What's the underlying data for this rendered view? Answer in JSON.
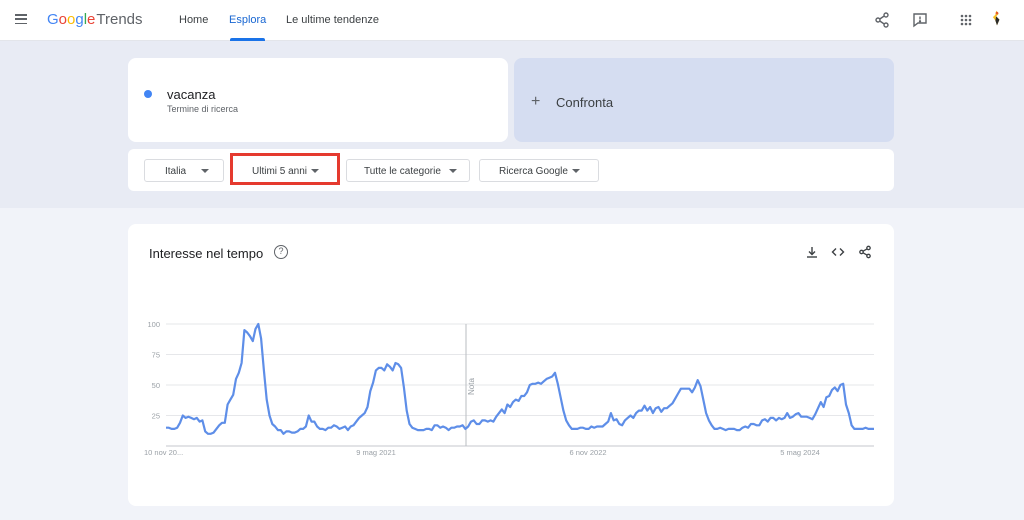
{
  "header": {
    "logo": {
      "google": "Google",
      "trends": "Trends"
    },
    "tabs": [
      {
        "label": "Home",
        "active": false
      },
      {
        "label": "Esplora",
        "active": true
      },
      {
        "label": "Le ultime tendenze",
        "active": false
      }
    ],
    "icons": [
      "share-icon",
      "feedback-icon",
      "apps-grid-icon",
      "avatar"
    ]
  },
  "search": {
    "term": "vacanza",
    "term_type": "Termine di ricerca",
    "term_color": "#4285f4",
    "compare_label": "Confronta"
  },
  "filters": {
    "region": "Italia",
    "period": "Ultimi 5 anni",
    "category": "Tutte le categorie",
    "property": "Ricerca Google"
  },
  "interest": {
    "title": "Interesse nel tempo",
    "note_label": "Nota"
  },
  "chart_data": {
    "type": "line",
    "title": "Interesse nel tempo",
    "ylim": [
      0,
      100
    ],
    "y_ticks": [
      "100",
      "75",
      "50",
      "25"
    ],
    "x_tick_labels": [
      "10 nov 20...",
      "9 mag 2021",
      "6 nov 2022",
      "5 mag 2024"
    ],
    "grid": true,
    "series": [
      {
        "name": "vacanza",
        "color": "#4285f4",
        "values": [
          15,
          15,
          14,
          14,
          15,
          19,
          25,
          23,
          24,
          23,
          22,
          23,
          20,
          21,
          12,
          10,
          10,
          11,
          14,
          17,
          19,
          19,
          34,
          38,
          42,
          55,
          60,
          68,
          95,
          93,
          90,
          86,
          96,
          100,
          88,
          62,
          38,
          25,
          18,
          16,
          13,
          13,
          10,
          12,
          12,
          11,
          11,
          12,
          14,
          14,
          16,
          25,
          20,
          20,
          16,
          14,
          14,
          13,
          15,
          15,
          17,
          16,
          14,
          15,
          16,
          13,
          16,
          17,
          20,
          23,
          25,
          27,
          32,
          45,
          52,
          62,
          64,
          64,
          62,
          67,
          65,
          62,
          68,
          67,
          64,
          48,
          29,
          18,
          15,
          14,
          13,
          13,
          13,
          14,
          14,
          13,
          17,
          17,
          15,
          16,
          15,
          13,
          15,
          15,
          16,
          16,
          17,
          14,
          16,
          20,
          21,
          18,
          18,
          21,
          21,
          20,
          21,
          20,
          24,
          27,
          30,
          27,
          34,
          32,
          36,
          38,
          37,
          41,
          41,
          44,
          50,
          51,
          51,
          52,
          51,
          53,
          55,
          56,
          57,
          60,
          51,
          40,
          29,
          21,
          17,
          14,
          14,
          14,
          15,
          15,
          14,
          14,
          16,
          15,
          16,
          16,
          16,
          18,
          20,
          27,
          21,
          22,
          18,
          17,
          21,
          23,
          25,
          23,
          27,
          29,
          29,
          33,
          29,
          32,
          27,
          31,
          32,
          28,
          31,
          31,
          33,
          35,
          39,
          43,
          47,
          47,
          47,
          47,
          44,
          48,
          54,
          49,
          38,
          27,
          21,
          17,
          14,
          14,
          15,
          14,
          13,
          14,
          14,
          14,
          13,
          13,
          15,
          16,
          15,
          18,
          18,
          17,
          17,
          21,
          22,
          20,
          23,
          23,
          21,
          23,
          22,
          23,
          27,
          23,
          24,
          26,
          27,
          24,
          24,
          24,
          23,
          22,
          26,
          31,
          36,
          32,
          40,
          41,
          46,
          48,
          45,
          50,
          51,
          34,
          27,
          17,
          14,
          14,
          14,
          14,
          15,
          14,
          14,
          14
        ]
      }
    ]
  }
}
